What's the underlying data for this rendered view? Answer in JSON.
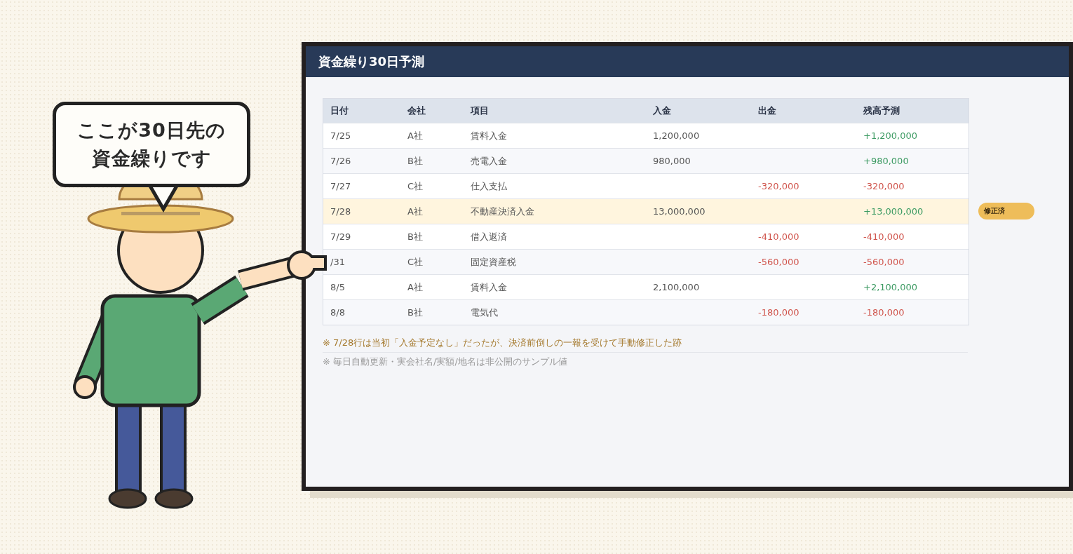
{
  "speech_bubble": {
    "lines": [
      "ここが30日先の",
      "資金繰りです"
    ]
  },
  "board": {
    "title": "資金繰り30日予測",
    "table": {
      "columns": [
        "日付",
        "会社",
        "項目",
        "入金",
        "出金",
        "残高予測"
      ],
      "rows": [
        {
          "date": "7/25",
          "company": "A社",
          "item": "賃料入金",
          "deposit": "1,200,000",
          "balance": "+1,200,000",
          "color": "#3c9a62",
          "highlighted": false
        },
        {
          "date": "7/26",
          "company": "B社",
          "item": "売電入金",
          "deposit": "980,000",
          "balance": "+980,000",
          "color": "#3c9a62",
          "highlighted": false
        },
        {
          "date": "7/27",
          "company": "C社",
          "item": "仕入支払",
          "withdrawal": "-320,000",
          "balance": "-320,000",
          "color": "#d0554d",
          "highlighted": false
        },
        {
          "date": "7/28",
          "company": "A社",
          "item": "不動産決済入金",
          "deposit": "13,000,000",
          "balance": "+13,000,000",
          "color": "#3c9a62",
          "highlighted": true,
          "badge": "修正済"
        },
        {
          "date": "7/29",
          "company": "B社",
          "item": "借入返済",
          "withdrawal": "-410,000",
          "balance": "-410,000",
          "color": "#d0554d",
          "highlighted": false
        },
        {
          "date": "/31",
          "company": "C社",
          "item": "固定資産税",
          "withdrawal": "-560,000",
          "balance": "-560,000",
          "color": "#d0554d",
          "highlighted": false
        },
        {
          "date": "8/5",
          "company": "A社",
          "item": "賃料入金",
          "deposit": "2,100,000",
          "balance": "+2,100,000",
          "color": "#3c9a62",
          "highlighted": false
        },
        {
          "date": "8/8",
          "company": "B社",
          "item": "電気代",
          "withdrawal": "-180,000",
          "balance": "-180,000",
          "color": "#d0554d",
          "highlighted": false
        }
      ]
    },
    "notes": [
      {
        "text": "※ 7/28行は当初「入金予定なし」だったが、決済前倒しの一報を受けて手動修正した跡",
        "kind": "highlight"
      },
      {
        "text": "※ 毎日自動更新・実会社名/実額/地名は非公開のサンプル値",
        "kind": "plain"
      }
    ]
  }
}
